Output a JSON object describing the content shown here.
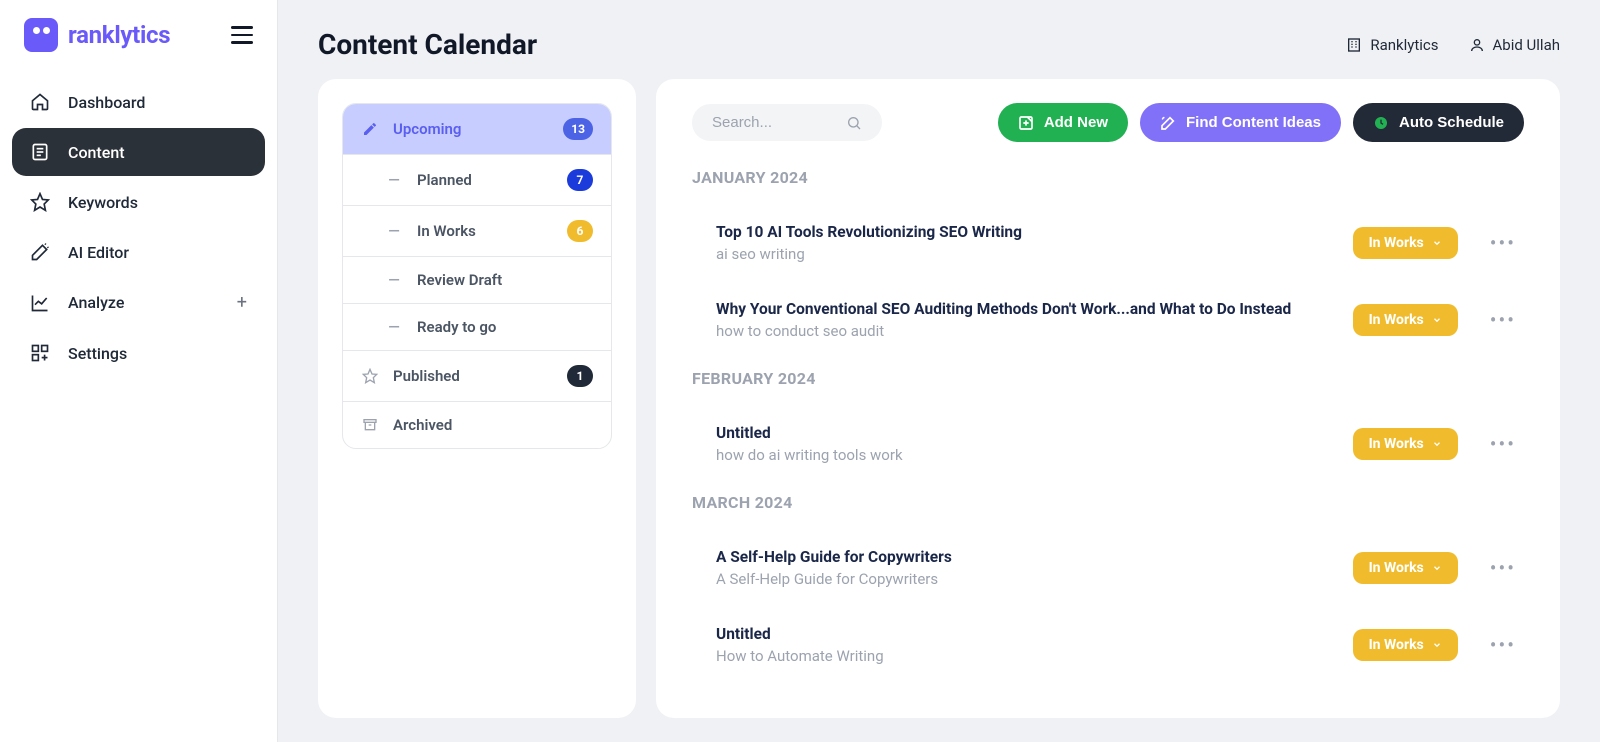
{
  "brand": {
    "name": "ranklytics"
  },
  "sidebar": {
    "items": [
      {
        "label": "Dashboard"
      },
      {
        "label": "Content"
      },
      {
        "label": "Keywords"
      },
      {
        "label": "AI Editor"
      },
      {
        "label": "Analyze",
        "trail": "+"
      },
      {
        "label": "Settings"
      }
    ]
  },
  "header": {
    "title": "Content Calendar",
    "workspace": "Ranklytics",
    "user": "Abid Ullah"
  },
  "filters": {
    "upcoming": {
      "label": "Upcoming",
      "count": "13"
    },
    "planned": {
      "label": "Planned",
      "count": "7"
    },
    "in_works": {
      "label": "In Works",
      "count": "6"
    },
    "review": {
      "label": "Review Draft"
    },
    "ready": {
      "label": "Ready to go"
    },
    "published": {
      "label": "Published",
      "count": "1"
    },
    "archived": {
      "label": "Archived"
    }
  },
  "actions": {
    "search_placeholder": "Search...",
    "add_new": "Add New",
    "find_ideas": "Find Content Ideas",
    "auto_schedule": "Auto Schedule"
  },
  "months": [
    {
      "label": "JANUARY 2024",
      "articles": [
        {
          "title": "Top 10 AI Tools Revolutionizing SEO Writing",
          "keyword": "ai seo writing",
          "status": "In Works"
        },
        {
          "title": "Why Your Conventional SEO Auditing Methods Don't Work...and What to Do Instead",
          "keyword": "how to conduct seo audit",
          "status": "In Works"
        }
      ]
    },
    {
      "label": "FEBRUARY 2024",
      "articles": [
        {
          "title": "Untitled",
          "keyword": "how do ai writing tools work",
          "status": "In Works"
        }
      ]
    },
    {
      "label": "MARCH 2024",
      "articles": [
        {
          "title": "A Self-Help Guide for Copywriters",
          "keyword": "A Self-Help Guide for Copywriters",
          "status": "In Works"
        },
        {
          "title": "Untitled",
          "keyword": "How to Automate Writing",
          "status": "In Works"
        }
      ]
    }
  ]
}
